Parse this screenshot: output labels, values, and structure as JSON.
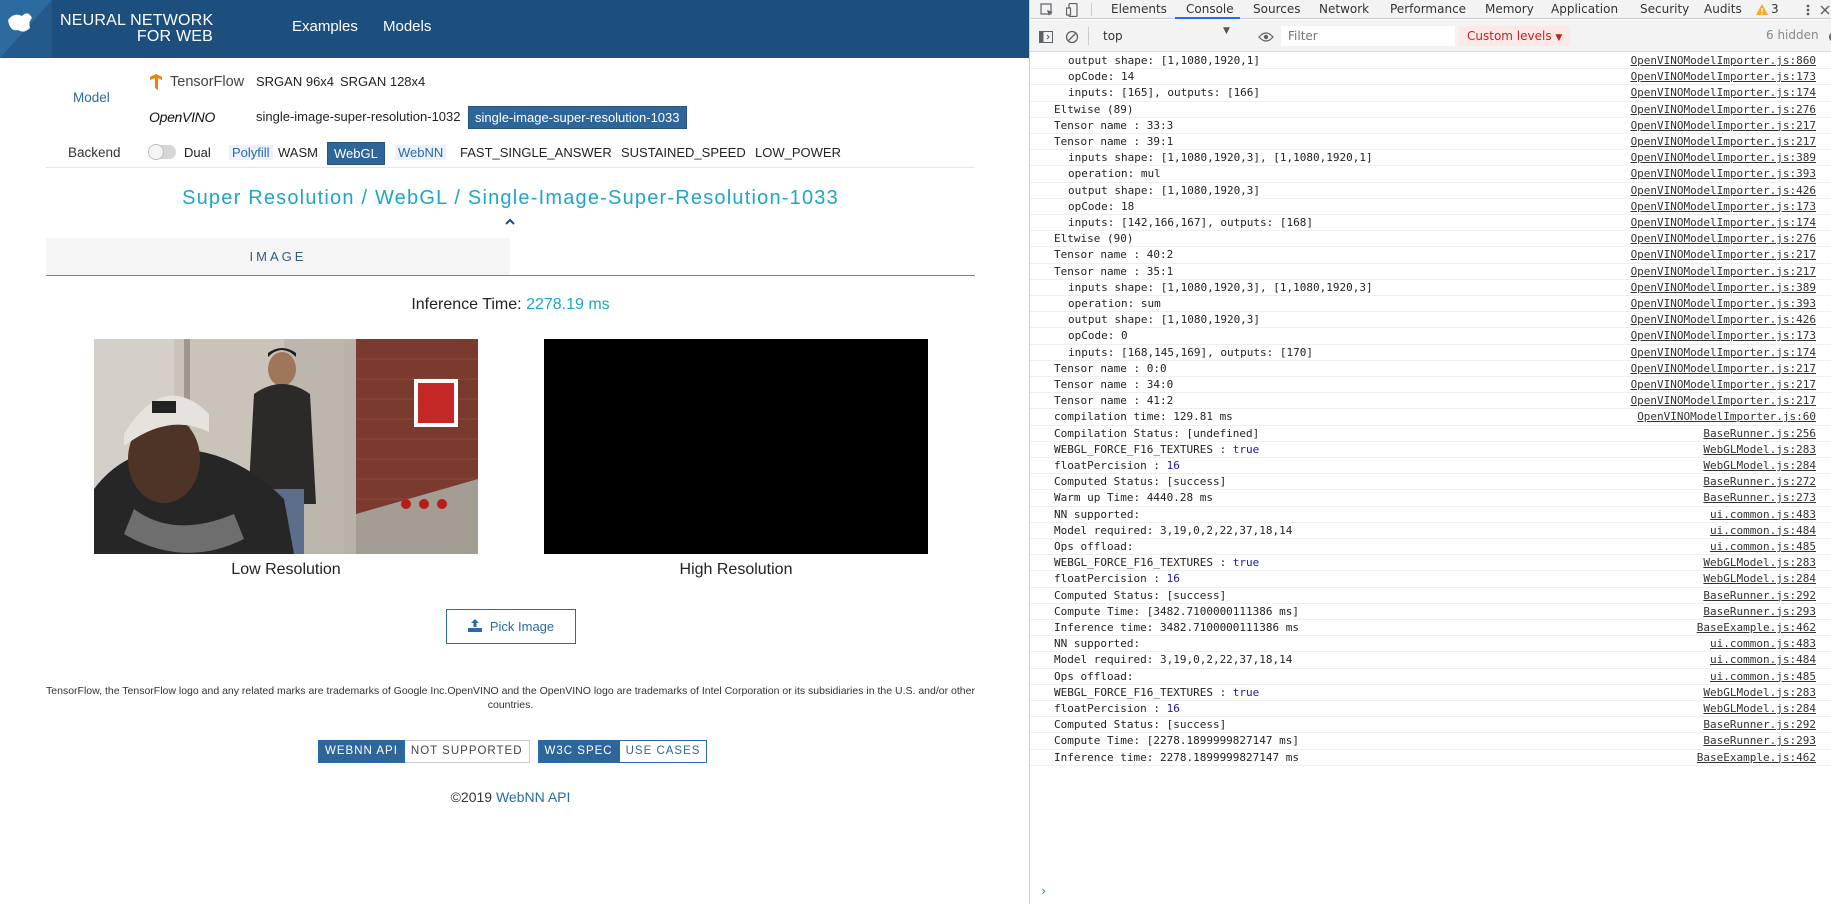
{
  "header": {
    "brand_line1": "NEURAL NETWORK",
    "brand_line2": "FOR WEB",
    "nav": [
      "Examples",
      "Models"
    ]
  },
  "model_section": {
    "label": "Model",
    "tensorflow_label": "TensorFlow",
    "tf_models": [
      "SRGAN 96x4",
      "SRGAN 128x4"
    ],
    "openvino_label": "OpenVINO",
    "ov_models": [
      "single-image-super-resolution-1032",
      "single-image-super-resolution-1033"
    ]
  },
  "backend_section": {
    "label": "Backend",
    "dual_label": "Dual",
    "polyfill_label": "Polyfill",
    "polyfill_opts": [
      "WASM",
      "WebGL"
    ],
    "webnn_label": "WebNN",
    "webnn_opts": [
      "FAST_SINGLE_ANSWER",
      "SUSTAINED_SPEED",
      "LOW_POWER"
    ]
  },
  "title": "Super Resolution / WebGL / Single-Image-Super-Resolution-1033",
  "tab_image": "IMAGE",
  "inference": {
    "label": "Inference Time:",
    "value": "2278.19 ms"
  },
  "captions": {
    "low": "Low Resolution",
    "high": "High Resolution"
  },
  "pick_button": "Pick Image",
  "disclaimer_line1": "TensorFlow, the TensorFlow logo and any related marks are trademarks of Google Inc.OpenVINO and the OpenVINO logo are trademarks of Intel Corporation or its subsidiaries in the U.S. and/or other",
  "disclaimer_line2": "countries.",
  "badges": {
    "webnn_api": "WEBNN API",
    "not_supported": "NOT SUPPORTED",
    "w3c_spec": "W3C SPEC",
    "use_cases": "USE CASES"
  },
  "copyright": {
    "text": "©2019",
    "link": "WebNN API"
  },
  "devtools": {
    "tabs": [
      "Elements",
      "Console",
      "Sources",
      "Network",
      "Performance",
      "Memory",
      "Application",
      "Security",
      "Audits"
    ],
    "active_tab": "Console",
    "warning_count": "3",
    "context": "top",
    "filter_placeholder": "Filter",
    "levels": "Custom levels",
    "hidden": "6 hidden",
    "accent": "#1a73e8",
    "lines": [
      {
        "msg": "output shape: [1,1080,1920,1]",
        "src": "OpenVINOModelImporter.js:860",
        "indent": true
      },
      {
        "msg": "opCode: 14",
        "src": "OpenVINOModelImporter.js:173",
        "indent": true
      },
      {
        "msg": "inputs: [165], outputs: [166]",
        "src": "OpenVINOModelImporter.js:174",
        "indent": true
      },
      {
        "msg": "Eltwise (89)",
        "src": "OpenVINOModelImporter.js:276",
        "indent": false
      },
      {
        "msg": "Tensor name : 33:3",
        "src": "OpenVINOModelImporter.js:217",
        "indent": false
      },
      {
        "msg": "Tensor name : 39:1",
        "src": "OpenVINOModelImporter.js:217",
        "indent": false
      },
      {
        "msg": "inputs shape: [1,1080,1920,3], [1,1080,1920,1]",
        "src": "OpenVINOModelImporter.js:389",
        "indent": true
      },
      {
        "msg": "operation: mul",
        "src": "OpenVINOModelImporter.js:393",
        "indent": true
      },
      {
        "msg": "output shape: [1,1080,1920,3]",
        "src": "OpenVINOModelImporter.js:426",
        "indent": true
      },
      {
        "msg": "opCode: 18",
        "src": "OpenVINOModelImporter.js:173",
        "indent": true
      },
      {
        "msg": "inputs: [142,166,167], outputs: [168]",
        "src": "OpenVINOModelImporter.js:174",
        "indent": true
      },
      {
        "msg": "Eltwise (90)",
        "src": "OpenVINOModelImporter.js:276",
        "indent": false
      },
      {
        "msg": "Tensor name : 40:2",
        "src": "OpenVINOModelImporter.js:217",
        "indent": false
      },
      {
        "msg": "Tensor name : 35:1",
        "src": "OpenVINOModelImporter.js:217",
        "indent": false
      },
      {
        "msg": "inputs shape: [1,1080,1920,3], [1,1080,1920,3]",
        "src": "OpenVINOModelImporter.js:389",
        "indent": true
      },
      {
        "msg": "operation: sum",
        "src": "OpenVINOModelImporter.js:393",
        "indent": true
      },
      {
        "msg": "output shape: [1,1080,1920,3]",
        "src": "OpenVINOModelImporter.js:426",
        "indent": true
      },
      {
        "msg": "opCode: 0",
        "src": "OpenVINOModelImporter.js:173",
        "indent": true
      },
      {
        "msg": "inputs: [168,145,169], outputs: [170]",
        "src": "OpenVINOModelImporter.js:174",
        "indent": true
      },
      {
        "msg": "Tensor name : 0:0",
        "src": "OpenVINOModelImporter.js:217",
        "indent": false
      },
      {
        "msg": "Tensor name : 34:0",
        "src": "OpenVINOModelImporter.js:217",
        "indent": false
      },
      {
        "msg": "Tensor name : 41:2",
        "src": "OpenVINOModelImporter.js:217",
        "indent": false
      },
      {
        "msg": "compilation time: 129.81 ms",
        "src": "OpenVINOModelImporter.js:60",
        "indent": false
      },
      {
        "msg": "Compilation Status: [undefined]",
        "src": "BaseRunner.js:256",
        "indent": false
      },
      {
        "msg": "WEBGL_FORCE_F16_TEXTURES :",
        "kw": "true",
        "src": "WebGLModel.js:283",
        "indent": false
      },
      {
        "msg": "floatPercision :",
        "kw": "16",
        "src": "WebGLModel.js:284",
        "indent": false
      },
      {
        "msg": "Computed Status: [success]",
        "src": "BaseRunner.js:272",
        "indent": false
      },
      {
        "msg": "Warm up Time: 4440.28 ms",
        "src": "BaseRunner.js:273",
        "indent": false
      },
      {
        "msg": "NN supported:",
        "src": "ui.common.js:483",
        "indent": false
      },
      {
        "msg": "Model required: 3,19,0,2,22,37,18,14",
        "src": "ui.common.js:484",
        "indent": false
      },
      {
        "msg": "Ops offload:",
        "src": "ui.common.js:485",
        "indent": false
      },
      {
        "msg": "WEBGL_FORCE_F16_TEXTURES :",
        "kw": "true",
        "src": "WebGLModel.js:283",
        "indent": false
      },
      {
        "msg": "floatPercision :",
        "kw": "16",
        "src": "WebGLModel.js:284",
        "indent": false
      },
      {
        "msg": "Computed Status: [success]",
        "src": "BaseRunner.js:292",
        "indent": false
      },
      {
        "msg": "Compute Time: [3482.7100000111386 ms]",
        "src": "BaseRunner.js:293",
        "indent": false
      },
      {
        "msg": "Inference time: 3482.7100000111386 ms",
        "src": "BaseExample.js:462",
        "indent": false
      },
      {
        "msg": "NN supported:",
        "src": "ui.common.js:483",
        "indent": false
      },
      {
        "msg": "Model required: 3,19,0,2,22,37,18,14",
        "src": "ui.common.js:484",
        "indent": false
      },
      {
        "msg": "Ops offload:",
        "src": "ui.common.js:485",
        "indent": false
      },
      {
        "msg": "WEBGL_FORCE_F16_TEXTURES :",
        "kw": "true",
        "src": "WebGLModel.js:283",
        "indent": false
      },
      {
        "msg": "floatPercision :",
        "kw": "16",
        "src": "WebGLModel.js:284",
        "indent": false
      },
      {
        "msg": "Computed Status: [success]",
        "src": "BaseRunner.js:292",
        "indent": false
      },
      {
        "msg": "Compute Time: [2278.1899999827147 ms]",
        "src": "BaseRunner.js:293",
        "indent": false
      },
      {
        "msg": "Inference time: 2278.1899999827147 ms",
        "src": "BaseExample.js:462",
        "indent": false
      }
    ]
  }
}
